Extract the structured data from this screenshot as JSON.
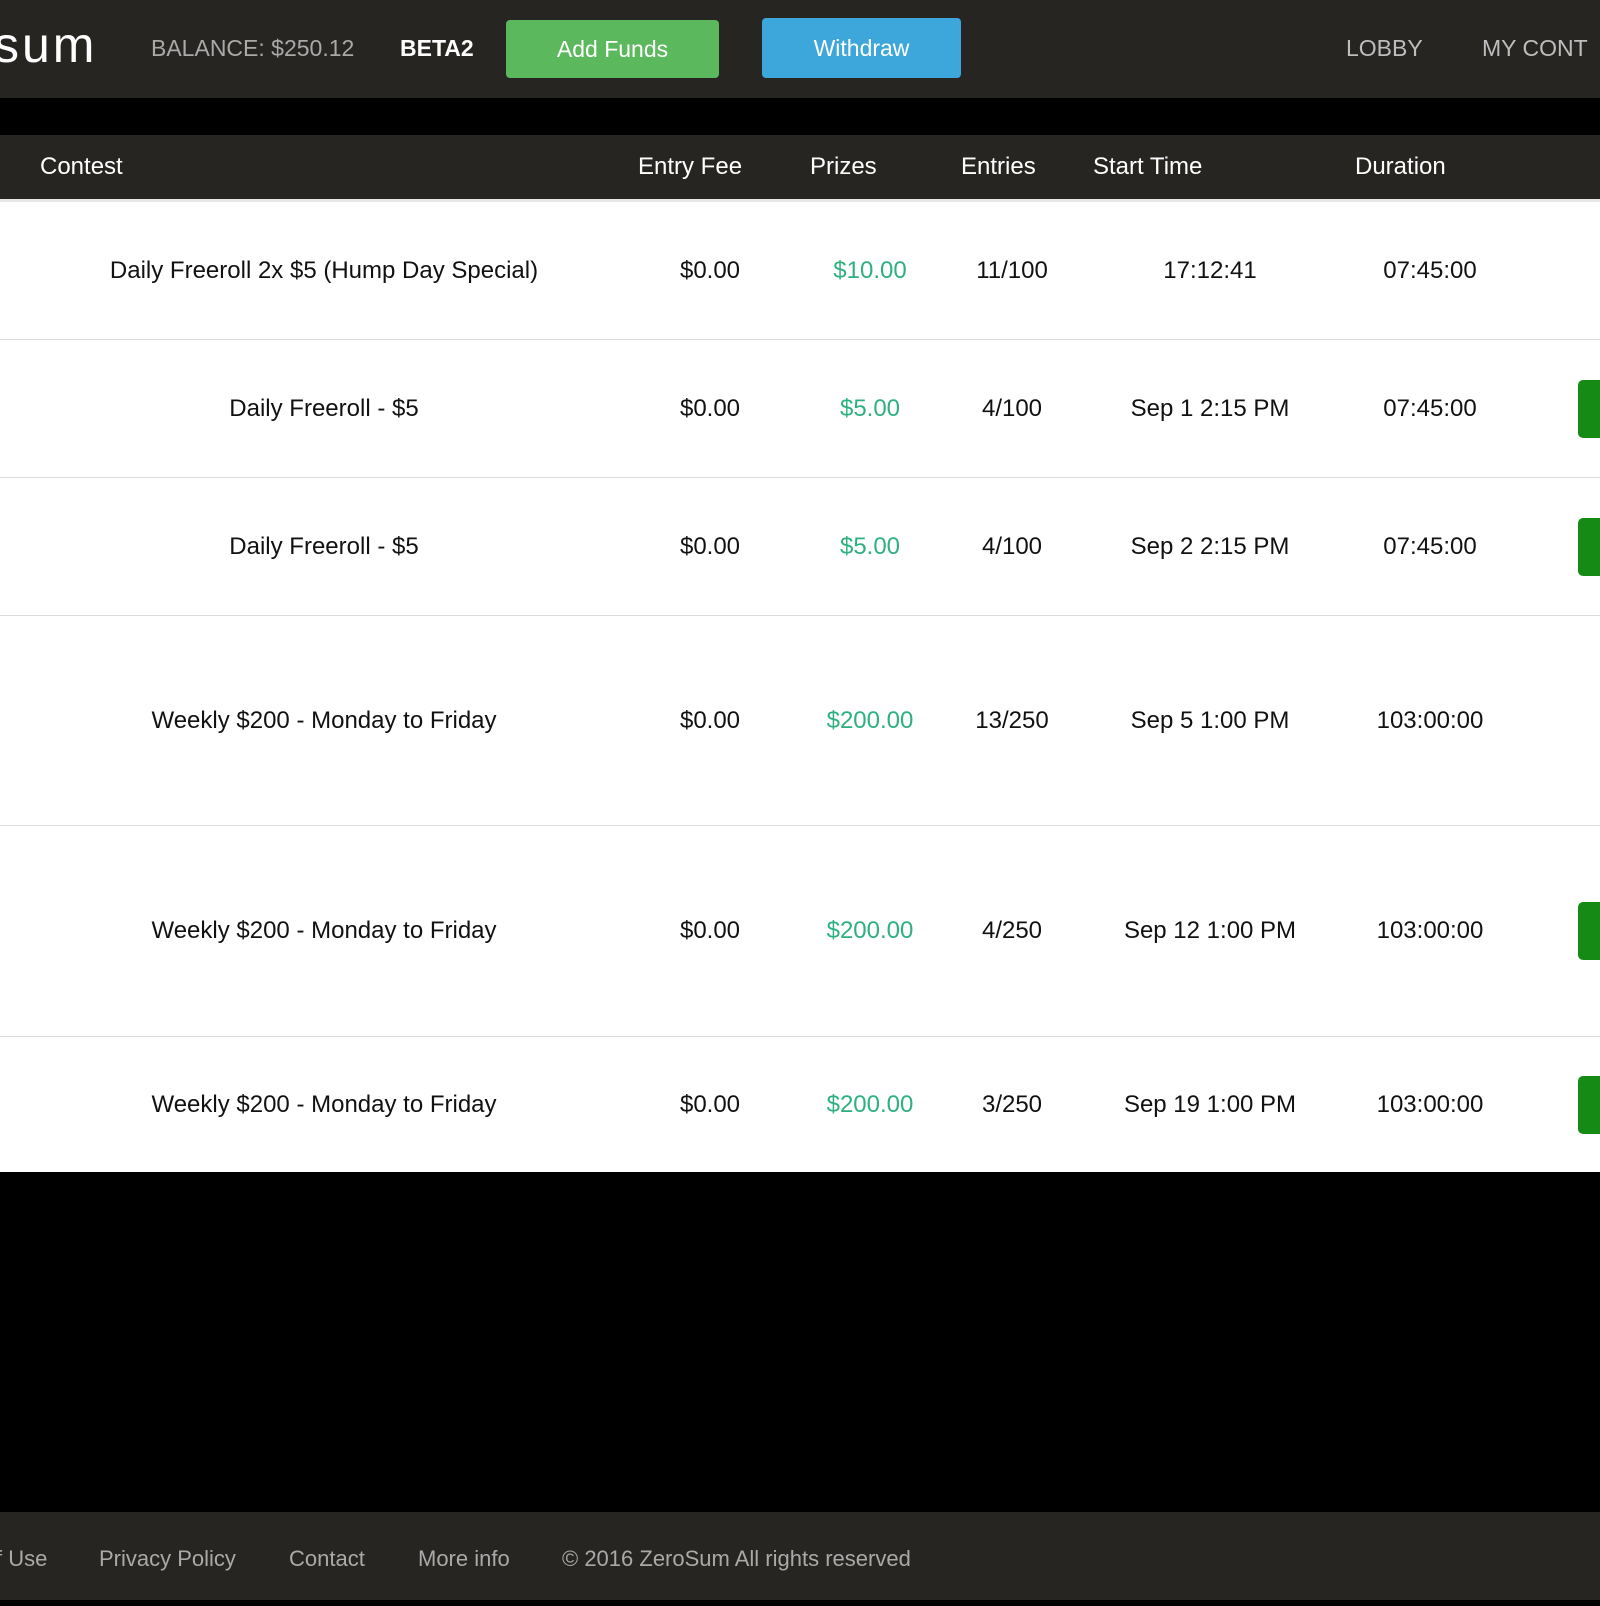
{
  "navbar": {
    "logo": "sum",
    "balance": "BALANCE: $250.12",
    "beta": "BETA2",
    "add_funds": "Add Funds",
    "withdraw": "Withdraw",
    "links": [
      "LOBBY",
      "MY CONT"
    ],
    "colors": {
      "add_funds": "#5cb85c",
      "withdraw": "#3da7dc",
      "bar": "#262522"
    }
  },
  "table": {
    "columns": [
      "Contest",
      "Entry Fee",
      "Prizes",
      "Entries",
      "Start Time",
      "Duration"
    ],
    "rows": [
      {
        "contest": "Daily Freeroll 2x $5 (Hump Day Special)",
        "entry_fee": "$0.00",
        "prizes": "$10.00",
        "entries": "11/100",
        "start_time": "17:12:41",
        "duration": "07:45:00",
        "has_button": false
      },
      {
        "contest": "Daily Freeroll - $5",
        "entry_fee": "$0.00",
        "prizes": "$5.00",
        "entries": "4/100",
        "start_time": "Sep 1 2:15 PM",
        "duration": "07:45:00",
        "has_button": true
      },
      {
        "contest": "Daily Freeroll - $5",
        "entry_fee": "$0.00",
        "prizes": "$5.00",
        "entries": "4/100",
        "start_time": "Sep 2 2:15 PM",
        "duration": "07:45:00",
        "has_button": true
      },
      {
        "contest": "Weekly $200 - Monday to Friday",
        "entry_fee": "$0.00",
        "prizes": "$200.00",
        "entries": "13/250",
        "start_time": "Sep 5 1:00 PM",
        "duration": "103:00:00",
        "has_button": false
      },
      {
        "contest": "Weekly $200 - Monday to Friday",
        "entry_fee": "$0.00",
        "prizes": "$200.00",
        "entries": "4/250",
        "start_time": "Sep 12 1:00 PM",
        "duration": "103:00:00",
        "has_button": true
      },
      {
        "contest": "Weekly $200 - Monday to Friday",
        "entry_fee": "$0.00",
        "prizes": "$200.00",
        "entries": "3/250",
        "start_time": "Sep 19 1:00 PM",
        "duration": "103:00:00",
        "has_button": true
      }
    ],
    "colors": {
      "prize_text": "#2fb07f",
      "enter_button": "#158a15"
    }
  },
  "footer": {
    "links": [
      "f Use",
      "Privacy Policy",
      "Contact",
      "More info"
    ],
    "copyright": "© 2016 ZeroSum All rights reserved"
  }
}
